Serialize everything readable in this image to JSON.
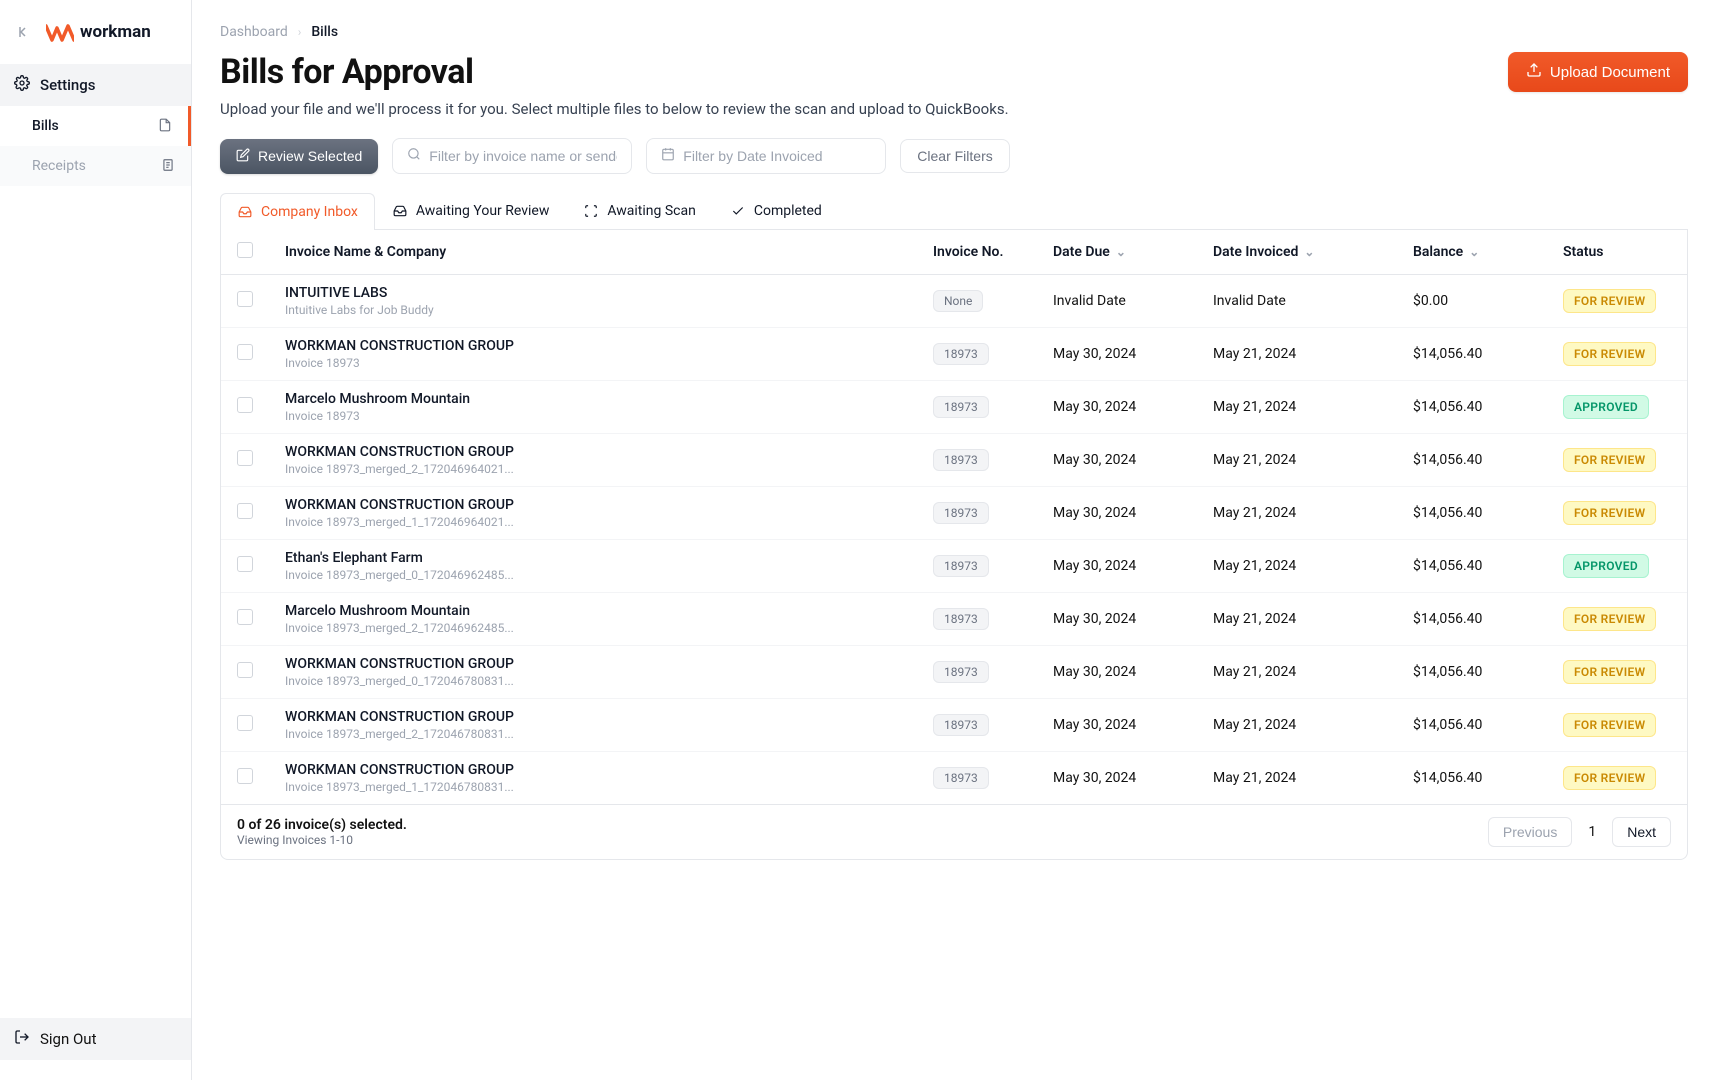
{
  "brand": {
    "name": "workman"
  },
  "sidebar": {
    "settings_label": "Settings",
    "bills_label": "Bills",
    "receipts_label": "Receipts",
    "signout_label": "Sign Out"
  },
  "breadcrumb": {
    "dashboard": "Dashboard",
    "bills": "Bills"
  },
  "header": {
    "title": "Bills for Approval",
    "subtitle": "Upload your file and we'll process it for you. Select multiple files to below to review the scan and upload to QuickBooks.",
    "upload_label": "Upload Document"
  },
  "filters": {
    "review_label": "Review Selected",
    "name_placeholder": "Filter by invoice name or sender",
    "date_placeholder": "Filter by Date Invoiced",
    "clear_label": "Clear Filters"
  },
  "tabs": {
    "company_inbox": "Company Inbox",
    "awaiting_review": "Awaiting Your Review",
    "awaiting_scan": "Awaiting Scan",
    "completed": "Completed"
  },
  "table": {
    "headers": {
      "name": "Invoice Name & Company",
      "invoice_no": "Invoice No.",
      "date_due": "Date Due",
      "date_invoiced": "Date Invoiced",
      "balance": "Balance",
      "status": "Status"
    },
    "rows": [
      {
        "company": "INTUITIVE LABS",
        "sub": "Intuitive Labs for Job Buddy",
        "invoice_no": "None",
        "date_due": "Invalid Date",
        "date_invoiced": "Invalid Date",
        "balance": "$0.00",
        "status": "FOR REVIEW",
        "status_kind": "review"
      },
      {
        "company": "WORKMAN CONSTRUCTION GROUP",
        "sub": "Invoice 18973",
        "invoice_no": "18973",
        "date_due": "May 30, 2024",
        "date_invoiced": "May 21, 2024",
        "balance": "$14,056.40",
        "status": "FOR REVIEW",
        "status_kind": "review"
      },
      {
        "company": "Marcelo Mushroom Mountain",
        "sub": "Invoice 18973",
        "invoice_no": "18973",
        "date_due": "May 30, 2024",
        "date_invoiced": "May 21, 2024",
        "balance": "$14,056.40",
        "status": "APPROVED",
        "status_kind": "approved"
      },
      {
        "company": "WORKMAN CONSTRUCTION GROUP",
        "sub": "Invoice 18973_merged_2_172046964021...",
        "invoice_no": "18973",
        "date_due": "May 30, 2024",
        "date_invoiced": "May 21, 2024",
        "balance": "$14,056.40",
        "status": "FOR REVIEW",
        "status_kind": "review"
      },
      {
        "company": "WORKMAN CONSTRUCTION GROUP",
        "sub": "Invoice 18973_merged_1_172046964021...",
        "invoice_no": "18973",
        "date_due": "May 30, 2024",
        "date_invoiced": "May 21, 2024",
        "balance": "$14,056.40",
        "status": "FOR REVIEW",
        "status_kind": "review"
      },
      {
        "company": "Ethan's Elephant Farm",
        "sub": "Invoice 18973_merged_0_172046962485...",
        "invoice_no": "18973",
        "date_due": "May 30, 2024",
        "date_invoiced": "May 21, 2024",
        "balance": "$14,056.40",
        "status": "APPROVED",
        "status_kind": "approved"
      },
      {
        "company": "Marcelo Mushroom Mountain",
        "sub": "Invoice 18973_merged_2_172046962485...",
        "invoice_no": "18973",
        "date_due": "May 30, 2024",
        "date_invoiced": "May 21, 2024",
        "balance": "$14,056.40",
        "status": "FOR REVIEW",
        "status_kind": "review"
      },
      {
        "company": "WORKMAN CONSTRUCTION GROUP",
        "sub": "Invoice 18973_merged_0_172046780831...",
        "invoice_no": "18973",
        "date_due": "May 30, 2024",
        "date_invoiced": "May 21, 2024",
        "balance": "$14,056.40",
        "status": "FOR REVIEW",
        "status_kind": "review"
      },
      {
        "company": "WORKMAN CONSTRUCTION GROUP",
        "sub": "Invoice 18973_merged_2_172046780831...",
        "invoice_no": "18973",
        "date_due": "May 30, 2024",
        "date_invoiced": "May 21, 2024",
        "balance": "$14,056.40",
        "status": "FOR REVIEW",
        "status_kind": "review"
      },
      {
        "company": "WORKMAN CONSTRUCTION GROUP",
        "sub": "Invoice 18973_merged_1_172046780831...",
        "invoice_no": "18973",
        "date_due": "May 30, 2024",
        "date_invoiced": "May 21, 2024",
        "balance": "$14,056.40",
        "status": "FOR REVIEW",
        "status_kind": "review"
      }
    ]
  },
  "pagination": {
    "selected": "0 of 26 invoice(s) selected.",
    "viewing": "Viewing Invoices 1-10",
    "previous": "Previous",
    "page": "1",
    "next": "Next"
  }
}
